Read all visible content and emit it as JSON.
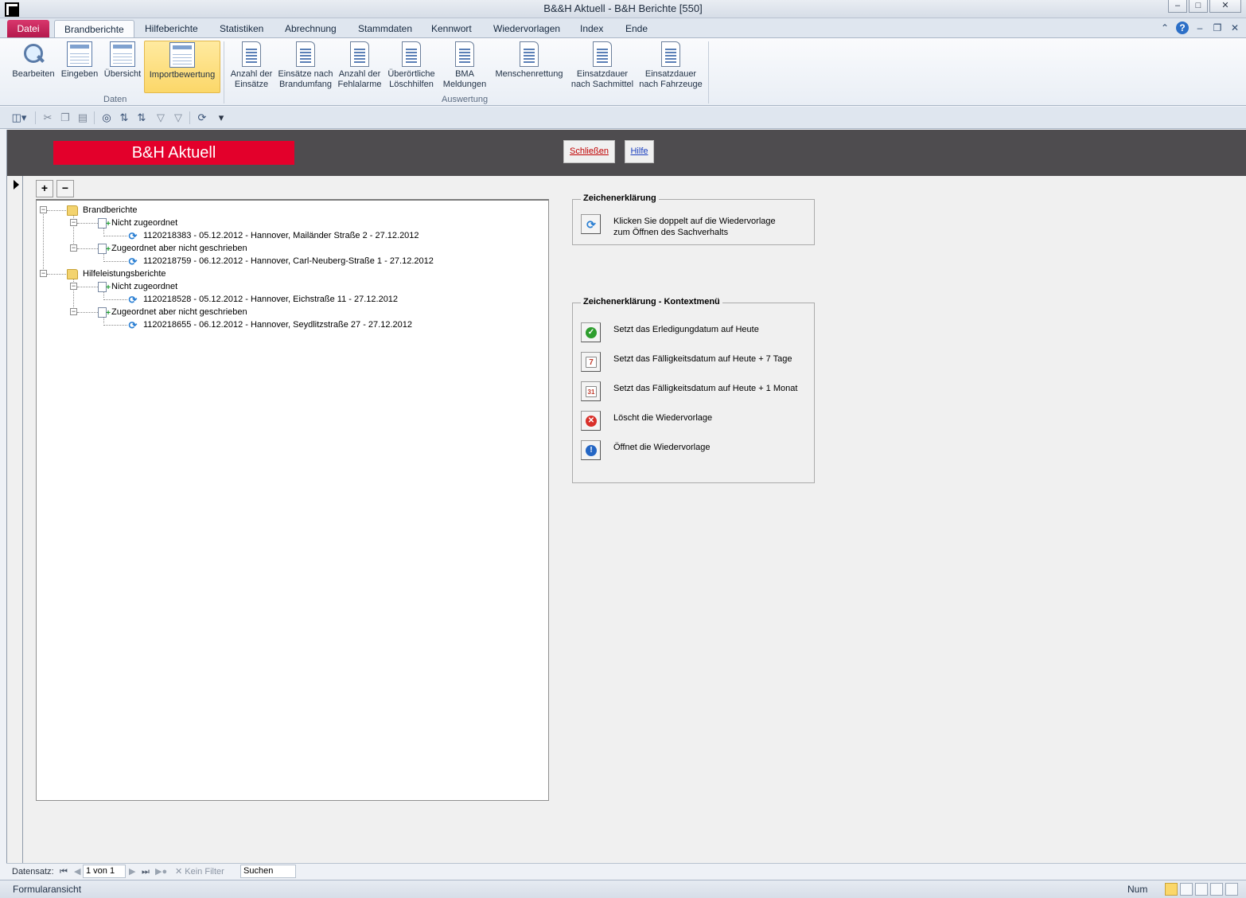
{
  "window": {
    "title": "B&&H Aktuell  -  B&H Berichte [550]",
    "controls": [
      "–",
      "□",
      "✕"
    ]
  },
  "ribbon_tabs": [
    {
      "label": "Datei"
    },
    {
      "label": "Brandberichte"
    },
    {
      "label": "Hilfeberichte"
    },
    {
      "label": "Statistiken"
    },
    {
      "label": "Abrechnung"
    },
    {
      "label": "Stammdaten"
    },
    {
      "label": "Kennwort"
    },
    {
      "label": "Wiedervorlagen"
    },
    {
      "label": "Index"
    },
    {
      "label": "Ende"
    }
  ],
  "ribbon": {
    "daten": {
      "label": "Daten",
      "buttons": [
        {
          "label": "Bearbeiten"
        },
        {
          "label": "Eingeben"
        },
        {
          "label": "Übersicht"
        },
        {
          "label": "Importbewertung"
        }
      ]
    },
    "auswertung": {
      "label": "Auswertung",
      "buttons": [
        {
          "line1": "Anzahl der",
          "line2": "Einsätze"
        },
        {
          "line1": "Einsätze nach",
          "line2": "Brandumfang"
        },
        {
          "line1": "Anzahl der",
          "line2": "Fehlalarme"
        },
        {
          "line1": "Überörtliche",
          "line2": "Löschhilfen"
        },
        {
          "line1": "BMA",
          "line2": "Meldungen"
        },
        {
          "line1": "Menschenrettung",
          "line2": ""
        },
        {
          "line1": "Einsatzdauer",
          "line2": "nach Sachmittel"
        },
        {
          "line1": "Einsatzdauer",
          "line2": "nach Fahrzeuge"
        }
      ]
    }
  },
  "form": {
    "brand_title": "B&H Aktuell",
    "close_button": "Schließen",
    "help_button": "Hilfe",
    "expand_all": "+",
    "collapse_all": "−"
  },
  "tree": {
    "brandberichte": {
      "label": "Brandberichte",
      "nicht_zugeordnet": {
        "label": "Nicht zugeordnet",
        "item": "1120218383 - 05.12.2012 - Hannover, Mailänder Straße  2 - 27.12.2012"
      },
      "zugeordnet": {
        "label": "Zugeordnet aber nicht geschrieben",
        "item": "1120218759 - 06.12.2012 - Hannover, Carl-Neuberg-Straße  1 - 27.12.2012"
      }
    },
    "hilfeleistungsberichte": {
      "label": "Hilfeleistungsberichte",
      "nicht_zugeordnet": {
        "label": "Nicht zugeordnet",
        "item": "1120218528 - 05.12.2012 - Hannover, Eichstraße  11 - 27.12.2012"
      },
      "zugeordnet": {
        "label": "Zugeordnet aber nicht geschrieben",
        "item": "1120218655 - 06.12.2012 - Hannover, Seydlitzstraße  27 - 27.12.2012"
      }
    }
  },
  "legend": {
    "title": "Zeichenerklärung",
    "line1": "Klicken Sie doppelt auf die Wiedervorlage",
    "line2": "zum Öffnen des Sachverhalts"
  },
  "legend_context": {
    "title": "Zeichenerklärung - Kontextmenü",
    "items": [
      {
        "text": "Setzt das Erledigungdatum auf Heute",
        "icon": "check-icon",
        "color": "#2e9e2e"
      },
      {
        "text": "Setzt das Fälligkeitsdatum auf Heute + 7 Tage",
        "icon": "calendar-week-icon",
        "color": "#c03a2b"
      },
      {
        "text": "Setzt das Fälligkeitsdatum auf Heute + 1 Monat",
        "icon": "calendar-month-icon",
        "color": "#c03a2b"
      },
      {
        "text": "Löscht die Wiedervorlage",
        "icon": "delete-icon",
        "color": "#d9302a"
      },
      {
        "text": "Öffnet die Wiedervorlage",
        "icon": "info-icon",
        "color": "#2466c4"
      }
    ]
  },
  "navigator": {
    "label": "Datensatz:",
    "position": "1 von 1",
    "filter": "Kein Filter",
    "search": "Suchen"
  },
  "status": {
    "view": "Formularansicht",
    "num": "Num"
  }
}
